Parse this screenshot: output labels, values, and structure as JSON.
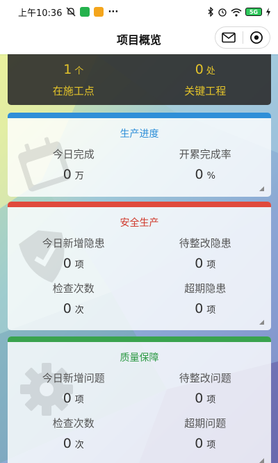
{
  "status_bar": {
    "time": "上午10:36",
    "more": "···",
    "network_label": "5G"
  },
  "nav": {
    "title": "项目概览"
  },
  "summary": {
    "items": [
      {
        "value": "1",
        "unit": "个",
        "label": "在施工点"
      },
      {
        "value": "0",
        "unit": "处",
        "label": "关键工程"
      }
    ]
  },
  "cards": {
    "progress": {
      "title": "生产进度",
      "accent": "#2f8fd8",
      "metrics": [
        {
          "label": "今日完成",
          "value": "0",
          "unit": "万"
        },
        {
          "label": "开累完成率",
          "value": "0",
          "unit": "%"
        }
      ]
    },
    "safety": {
      "title": "安全生产",
      "accent": "#e04a3c",
      "metrics": [
        {
          "label": "今日新增隐患",
          "value": "0",
          "unit": "项"
        },
        {
          "label": "待整改隐患",
          "value": "0",
          "unit": "项"
        },
        {
          "label": "检查次数",
          "value": "0",
          "unit": "次"
        },
        {
          "label": "超期隐患",
          "value": "0",
          "unit": "项"
        }
      ]
    },
    "quality": {
      "title": "质量保障",
      "accent": "#3aa34e",
      "metrics": [
        {
          "label": "今日新增问题",
          "value": "0",
          "unit": "项"
        },
        {
          "label": "待整改问题",
          "value": "0",
          "unit": "项"
        },
        {
          "label": "检查次数",
          "value": "0",
          "unit": "次"
        },
        {
          "label": "超期问题",
          "value": "0",
          "unit": "项"
        }
      ]
    }
  },
  "icons": {
    "status": [
      "mute-icon",
      "app-notification-icon",
      "app-notification-icon",
      "bluetooth-icon",
      "alarm-icon",
      "wifi-icon",
      "battery-icon"
    ],
    "capsule": [
      "message-icon",
      "close-miniprogram-icon"
    ],
    "watermarks": [
      "calendar-icon",
      "shield-icon",
      "gear-icon"
    ]
  }
}
